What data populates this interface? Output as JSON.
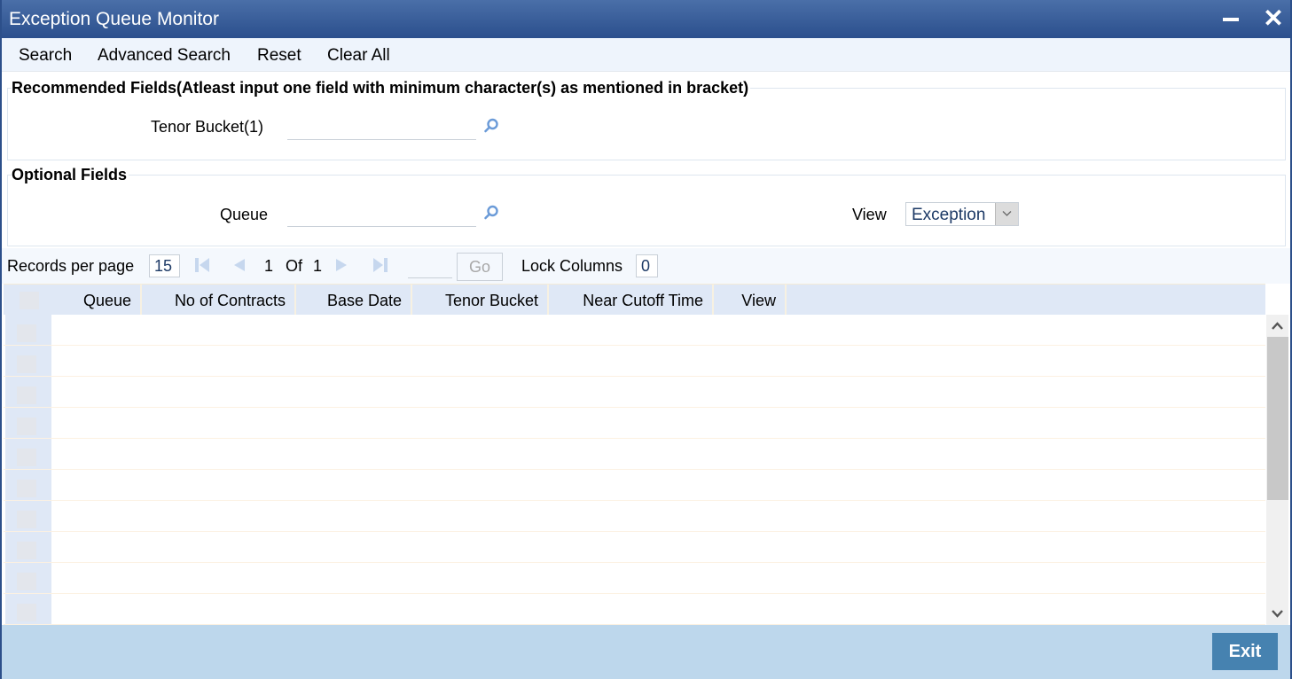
{
  "window": {
    "title": "Exception Queue Monitor",
    "minimize_icon": "minimize-icon",
    "close_icon": "close-icon",
    "close_glyph": "✕"
  },
  "toolbar": {
    "search_label": "Search",
    "advanced_search_label": "Advanced Search",
    "reset_label": "Reset",
    "clear_all_label": "Clear All"
  },
  "recommended": {
    "legend": "Recommended Fields(Atleast input one field with minimum character(s) as mentioned in bracket)",
    "fields": [
      {
        "label": "Tenor Bucket(1)",
        "value": "",
        "lov_icon": "search-icon"
      }
    ]
  },
  "optional": {
    "legend": "Optional Fields",
    "queue": {
      "label": "Queue",
      "value": "",
      "lov_icon": "search-icon"
    },
    "view": {
      "label": "View",
      "selected": "Exception"
    }
  },
  "pager": {
    "records_per_page_label": "Records per page",
    "records_per_page": "15",
    "current_page": "1",
    "of_label": "Of",
    "total_pages": "1",
    "goto_value": "",
    "go_label": "Go",
    "lock_columns_label": "Lock Columns",
    "lock_columns": "0"
  },
  "grid": {
    "columns": [
      "Queue",
      "No of Contracts",
      "Base Date",
      "Tenor Bucket",
      "Near Cutoff Time",
      "View"
    ],
    "rows": [
      [],
      [],
      [],
      [],
      [],
      [],
      [],
      [],
      [],
      []
    ]
  },
  "footer": {
    "exit_label": "Exit"
  },
  "colors": {
    "titlebar": "#2b4f8d",
    "toolbar_bg": "#eef4fc",
    "grid_header_bg": "#dfe8f6",
    "footer_bg": "#bdd7ec",
    "exit_button": "#4682b0",
    "lov_icon": "#6b9bd8"
  }
}
